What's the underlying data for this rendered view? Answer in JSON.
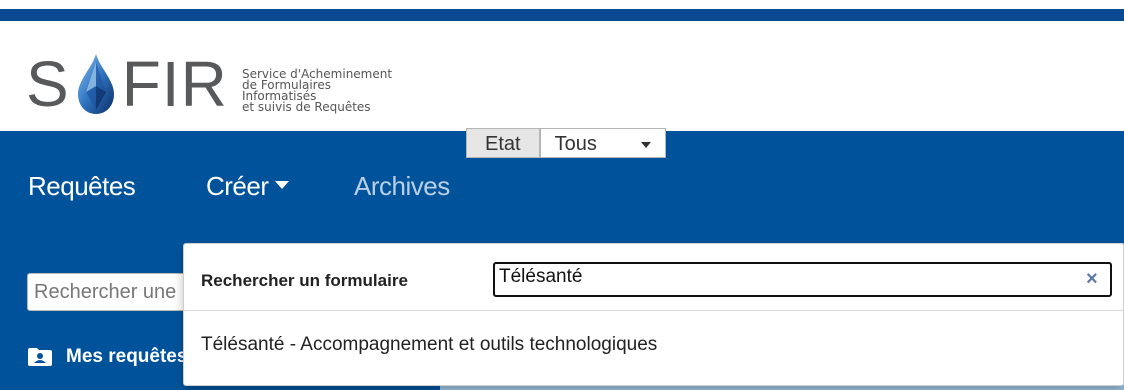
{
  "header": {
    "logo": {
      "letters_left": "S",
      "letters_right": "FIR",
      "tagline": [
        "Service d'Acheminement",
        "de Formulaires",
        "Informatisés",
        "et suivis de Requêtes"
      ]
    }
  },
  "navbar": {
    "items": [
      {
        "label": "Requêtes"
      },
      {
        "label": "Créer"
      },
      {
        "label": "Archives"
      }
    ]
  },
  "sidebar": {
    "search_placeholder": "Rechercher une requête",
    "mes_requetes": "Mes requêtes"
  },
  "main": {
    "etat_label": "Etat",
    "etat_value": "Tous"
  },
  "form_search": {
    "label": "Rechercher un formulaire",
    "value": "Télésanté",
    "clear": "×",
    "results": [
      "Télésanté - Accompagnement et outils technologiques"
    ]
  },
  "colors": {
    "primary": "#00539b",
    "stripe": "#0a4a92",
    "nav_text": "#ffffff",
    "nav_muted": "#b9cfe6"
  }
}
